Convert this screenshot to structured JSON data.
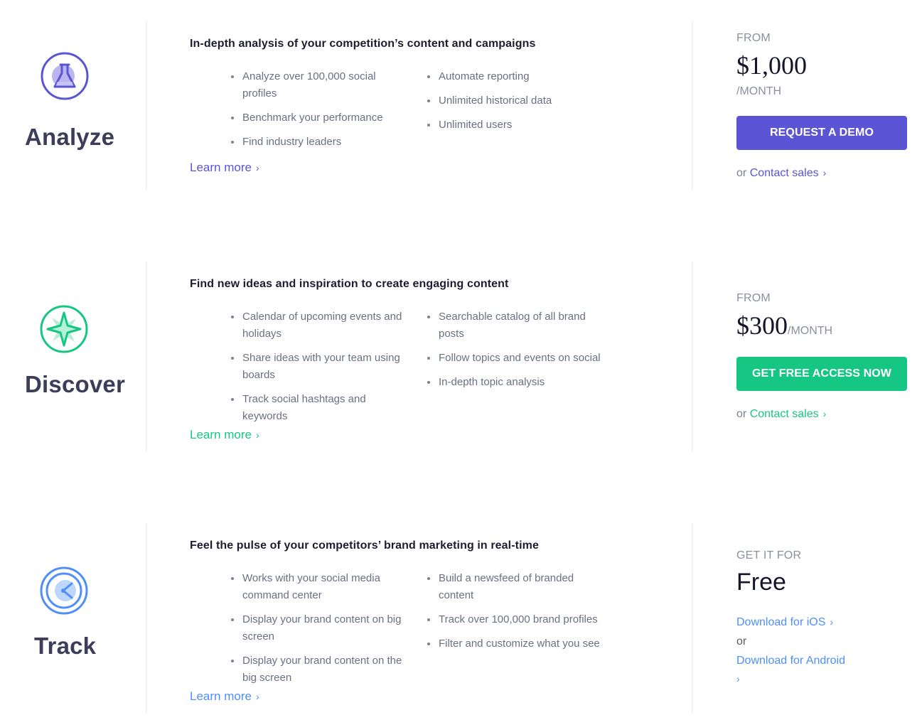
{
  "colors": {
    "analyze": "#5b55d6",
    "discover": "#16c784",
    "track": "#4f8ff7",
    "heading": "#3b3d5a",
    "body_text": "#697082",
    "muted": "#8b90a0"
  },
  "products": [
    {
      "name": "Analyze",
      "icon": "flask-icon",
      "headline": "In-depth analysis of your competition’s content and campaigns",
      "features_col1": [
        "Analyze over 100,000 social profiles",
        "Benchmark your performance",
        "Find industry leaders"
      ],
      "features_col2": [
        "Automate reporting",
        "Unlimited historical data",
        "Unlimited users"
      ],
      "learn_more": "Learn more",
      "pricing": {
        "prefix": "FROM",
        "price": "$1,000",
        "period": "/MONTH",
        "cta": "REQUEST A DEMO",
        "or": "or",
        "contact": "Contact sales"
      }
    },
    {
      "name": "Discover",
      "icon": "compass-star-icon",
      "headline": "Find new ideas and inspiration to create engaging content",
      "features_col1": [
        "Calendar of upcoming events and holidays",
        "Share ideas with your team using boards",
        "Track social hashtags and keywords"
      ],
      "features_col2": [
        "Searchable catalog of all brand posts",
        "Follow topics and events on social",
        "In-depth topic analysis"
      ],
      "learn_more": "Learn more",
      "pricing": {
        "prefix": "FROM",
        "price": "$300",
        "period": "/MONTH",
        "cta": "GET FREE ACCESS NOW",
        "or": "or",
        "contact": "Contact sales"
      }
    },
    {
      "name": "Track",
      "icon": "clock-radar-icon",
      "headline": "Feel the pulse of your competitors’ brand marketing in real-time",
      "features_col1": [
        "Works with your social media command center",
        "Display your brand content on big screen",
        "Display your brand content on the big screen"
      ],
      "features_col2": [
        "Build a newsfeed of branded content",
        "Track over 100,000 brand profiles",
        "Filter and customize what you see"
      ],
      "learn_more": "Learn more",
      "pricing": {
        "prefix": "GET IT FOR",
        "price": "Free",
        "ios": "Download for iOS",
        "or": "or",
        "android": "Download for Android"
      }
    }
  ]
}
